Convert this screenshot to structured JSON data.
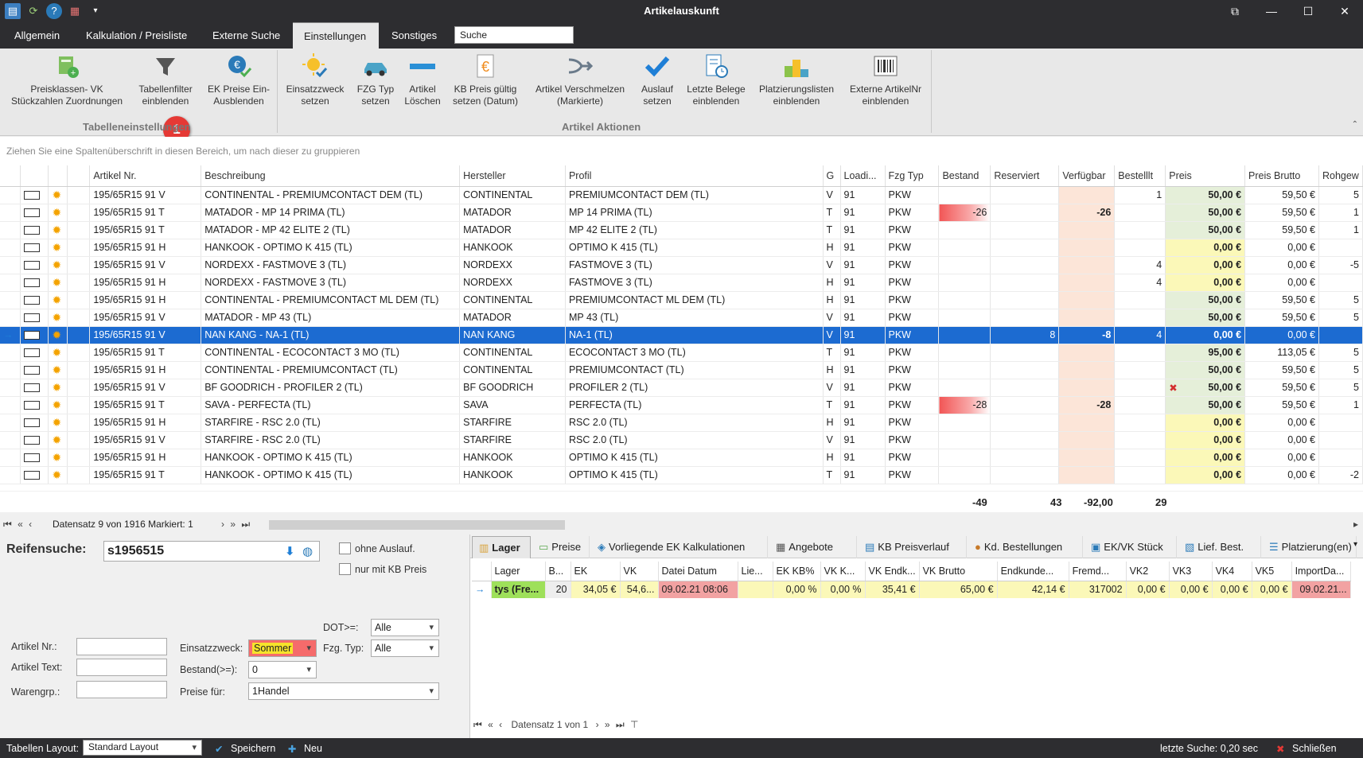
{
  "window": {
    "title": "Artikelauskunft"
  },
  "tabs": [
    "Allgemein",
    "Kalkulation / Preisliste",
    "Externe Suche",
    "Einstellungen",
    "Sonstiges"
  ],
  "search": {
    "value": "Suche"
  },
  "ribbon": {
    "buttons": [
      {
        "label": "Preisklassen- VK Stückzahlen Zuordnungen",
        "icon": "price-class-icon"
      },
      {
        "label": "Tabellenfilter einblenden",
        "icon": "filter-funnel-icon"
      },
      {
        "label": "EK Preise Ein- Ausblenden",
        "icon": "euro-check-icon"
      },
      {
        "label": "Einsatzzweck setzen",
        "icon": "sun-check-icon"
      },
      {
        "label": "FZG Typ setzen",
        "icon": "car-icon"
      },
      {
        "label": "Artikel Löschen",
        "icon": "minus-icon"
      },
      {
        "label": "KB Preis gültig setzen (Datum)",
        "icon": "euro-document-icon"
      },
      {
        "label": "Artikel Verschmelzen (Markierte)",
        "icon": "merge-arrow-icon"
      },
      {
        "label": "Auslauf setzen",
        "icon": "checkmark-icon"
      },
      {
        "label": "Letzte Belege einblenden",
        "icon": "receipt-clock-icon"
      },
      {
        "label": "Platzierungslisten einblenden",
        "icon": "podium-icon"
      },
      {
        "label": "Externe ArtikelNr einblenden",
        "icon": "barcode-icon"
      }
    ],
    "groups": [
      "Tabelleneinstellungen",
      "Artikel Aktionen"
    ],
    "badge": "1"
  },
  "group_panel": "Ziehen Sie eine Spaltenüberschrift in diesen Bereich, um nach dieser zu gruppieren",
  "grid": {
    "columns": [
      "Artikel Nr.",
      "Beschreibung",
      "Hersteller",
      "Profil",
      "G",
      "Loadi...",
      "Fzg Typ",
      "Bestand",
      "Reserviert",
      "Verfügbar",
      "Bestelllt",
      "Preis",
      "Preis Brutto",
      "Rohgew"
    ],
    "rows": [
      [
        "195/65R15 91 V",
        "CONTINENTAL - PREMIUMCONTACT DEM (TL)",
        "CONTINENTAL",
        "PREMIUMCONTACT DEM (TL)",
        "V",
        "91",
        "PKW",
        "",
        "",
        "",
        "1",
        "50,00 €",
        "59,50 €",
        "5"
      ],
      [
        "195/65R15 91 T",
        "MATADOR - MP 14 PRIMA (TL)",
        "MATADOR",
        "MP 14 PRIMA (TL)",
        "T",
        "91",
        "PKW",
        "-26",
        "",
        "-26",
        "",
        "50,00 €",
        "59,50 €",
        "1"
      ],
      [
        "195/65R15 91 T",
        "MATADOR - MP 42 ELITE 2 (TL)",
        "MATADOR",
        "MP 42 ELITE 2 (TL)",
        "T",
        "91",
        "PKW",
        "",
        "",
        "",
        "",
        "50,00 €",
        "59,50 €",
        "1"
      ],
      [
        "195/65R15 91 H",
        "HANKOOK - OPTIMO K 415 (TL)",
        "HANKOOK",
        "OPTIMO K 415 (TL)",
        "H",
        "91",
        "PKW",
        "",
        "",
        "",
        "",
        "0,00 €",
        "0,00 €",
        ""
      ],
      [
        "195/65R15 91 V",
        "NORDEXX - FASTMOVE 3 (TL)",
        "NORDEXX",
        "FASTMOVE 3 (TL)",
        "V",
        "91",
        "PKW",
        "",
        "",
        "",
        "4",
        "0,00 €",
        "0,00 €",
        "-5"
      ],
      [
        "195/65R15 91 H",
        "NORDEXX - FASTMOVE 3 (TL)",
        "NORDEXX",
        "FASTMOVE 3 (TL)",
        "H",
        "91",
        "PKW",
        "",
        "",
        "",
        "4",
        "0,00 €",
        "0,00 €",
        ""
      ],
      [
        "195/65R15 91 H",
        "CONTINENTAL - PREMIUMCONTACT ML DEM (TL)",
        "CONTINENTAL",
        "PREMIUMCONTACT ML DEM (TL)",
        "H",
        "91",
        "PKW",
        "",
        "",
        "",
        "",
        "50,00 €",
        "59,50 €",
        "5"
      ],
      [
        "195/65R15 91 V",
        "MATADOR - MP 43 (TL)",
        "MATADOR",
        "MP 43 (TL)",
        "V",
        "91",
        "PKW",
        "",
        "",
        "",
        "",
        "50,00 €",
        "59,50 €",
        "5"
      ],
      [
        "195/65R15 91 V",
        "NAN KANG - NA-1 (TL)",
        "NAN KANG",
        "NA-1 (TL)",
        "V",
        "91",
        "PKW",
        "",
        "8",
        "-8",
        "4",
        "0,00 €",
        "0,00 €",
        ""
      ],
      [
        "195/65R15 91 T",
        "CONTINENTAL - ECOCONTACT 3 MO (TL)",
        "CONTINENTAL",
        "ECOCONTACT 3 MO (TL)",
        "T",
        "91",
        "PKW",
        "",
        "",
        "",
        "",
        "95,00 €",
        "113,05 €",
        "5"
      ],
      [
        "195/65R15 91 H",
        "CONTINENTAL - PREMIUMCONTACT (TL)",
        "CONTINENTAL",
        "PREMIUMCONTACT (TL)",
        "H",
        "91",
        "PKW",
        "",
        "",
        "",
        "",
        "50,00 €",
        "59,50 €",
        "5"
      ],
      [
        "195/65R15 91 V",
        "BF GOODRICH - PROFILER 2 (TL)",
        "BF GOODRICH",
        "PROFILER 2 (TL)",
        "V",
        "91",
        "PKW",
        "",
        "",
        "",
        "",
        "50,00 €",
        "59,50 €",
        "5"
      ],
      [
        "195/65R15 91 T",
        "SAVA - PERFECTA (TL)",
        "SAVA",
        "PERFECTA (TL)",
        "T",
        "91",
        "PKW",
        "-28",
        "",
        "-28",
        "",
        "50,00 €",
        "59,50 €",
        "1"
      ],
      [
        "195/65R15 91 H",
        "STARFIRE - RSC 2.0 (TL)",
        "STARFIRE",
        "RSC 2.0 (TL)",
        "H",
        "91",
        "PKW",
        "",
        "",
        "",
        "",
        "0,00 €",
        "0,00 €",
        ""
      ],
      [
        "195/65R15 91 V",
        "STARFIRE - RSC 2.0 (TL)",
        "STARFIRE",
        "RSC 2.0 (TL)",
        "V",
        "91",
        "PKW",
        "",
        "",
        "",
        "",
        "0,00 €",
        "0,00 €",
        ""
      ],
      [
        "195/65R15 91 H",
        "HANKOOK - OPTIMO K 415 (TL)",
        "HANKOOK",
        "OPTIMO K 415 (TL)",
        "H",
        "91",
        "PKW",
        "",
        "",
        "",
        "",
        "0,00 €",
        "0,00 €",
        ""
      ],
      [
        "195/65R15 91 T",
        "HANKOOK - OPTIMO K 415 (TL)",
        "HANKOOK",
        "OPTIMO K 415 (TL)",
        "T",
        "91",
        "PKW",
        "",
        "",
        "",
        "",
        "0,00 €",
        "0,00 €",
        "-2"
      ]
    ],
    "selected_row": 8,
    "summary": {
      "bestand": "-49",
      "reserviert": "43",
      "verfuegbar": "-92,00",
      "bestellt": "29"
    },
    "navigator": "Datensatz 9 von 1916 Markiert: 1"
  },
  "search_panel": {
    "title": "Reifensuche:",
    "query": "s1956515",
    "ohne_auslauf": "ohne Auslauf.",
    "nur_kb": "nur mit KB Preis",
    "dot_label": "DOT>=:",
    "dot_value": "Alle",
    "artikel_nr_label": "Artikel Nr.:",
    "artikel_text_label": "Artikel Text:",
    "warengrp_label": "Warengrp.:",
    "einsatz_label": "Einsatzzweck:",
    "einsatz_value": "Sommer",
    "fzg_label": "Fzg. Typ:",
    "fzg_value": "Alle",
    "bestand_label": "Bestand(>=):",
    "bestand_value": "0",
    "preise_label": "Preise für:",
    "preise_value": "1Handel"
  },
  "detail": {
    "tabs": [
      "Lager",
      "Preise",
      "Vorliegende EK Kalkulationen",
      "Angebote",
      "KB Preisverlauf",
      "Kd. Bestellungen",
      "EK/VK Stück",
      "Lief. Best.",
      "Platzierung(en)"
    ],
    "columns": [
      "Lager",
      "B...",
      "EK",
      "VK",
      "Datei Datum",
      "Lie...",
      "EK KB%",
      "VK K...",
      "VK Endk...",
      "VK Brutto",
      "Endkunde...",
      "Fremd...",
      "VK2",
      "VK3",
      "VK4",
      "VK5",
      "ImportDa..."
    ],
    "row": [
      "tys (Fre...",
      "20",
      "34,05 €",
      "54,6...",
      "09.02.21 08:06",
      "",
      "0,00 %",
      "0,00 %",
      "35,41 €",
      "65,00 €",
      "42,14 €",
      "317002",
      "0,00 €",
      "0,00 €",
      "0,00 €",
      "0,00 €",
      "09.02.21..."
    ],
    "navigator": "Datensatz 1 von 1"
  },
  "status": {
    "layout_label": "Tabellen Layout:",
    "layout_value": "Standard Layout",
    "save": "Speichern",
    "new": "Neu",
    "last_search": "letzte Suche: 0,20 sec",
    "close": "Schließen"
  },
  "colors": {
    "accent": "#1c6bd1",
    "dark": "#2d2d30",
    "verfuegbar_bg": "#fce5d8",
    "price_green": "#e5efd9",
    "price_yellow": "#fbf8b8"
  }
}
